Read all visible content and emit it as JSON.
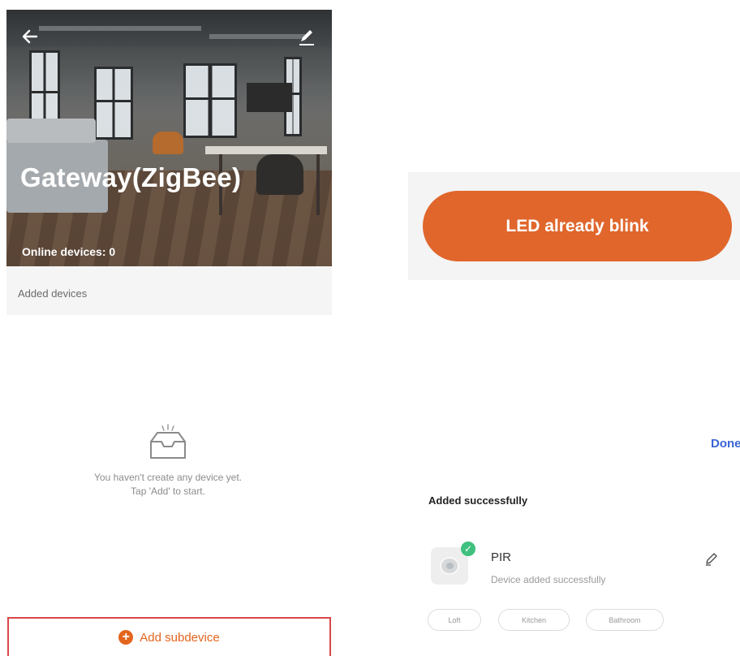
{
  "gateway": {
    "title": "Gateway(ZigBee)",
    "online_devices": "Online devices: 0",
    "added_devices_label": "Added devices",
    "empty_line1": "You haven't create any device yet.",
    "empty_line2": "Tap 'Add' to start.",
    "add_subdevice_label": "Add subdevice"
  },
  "led": {
    "button_label": "LED already blink"
  },
  "result": {
    "done_label": "Done",
    "section_title": "Added successfully",
    "device": {
      "name": "PIR",
      "status": "Device added successfully"
    },
    "rooms": [
      "Loft",
      "Kitchen",
      "Bathroom"
    ]
  },
  "colors": {
    "accent": "#e0662c",
    "success": "#3fc07e",
    "link": "#3b64d6",
    "highlight_border": "#d9474b"
  },
  "icons": [
    "back-arrow-icon",
    "edit-icon",
    "empty-box-icon",
    "plus-circle-icon",
    "pir-sensor-icon",
    "check-badge-icon",
    "pencil-icon"
  ]
}
